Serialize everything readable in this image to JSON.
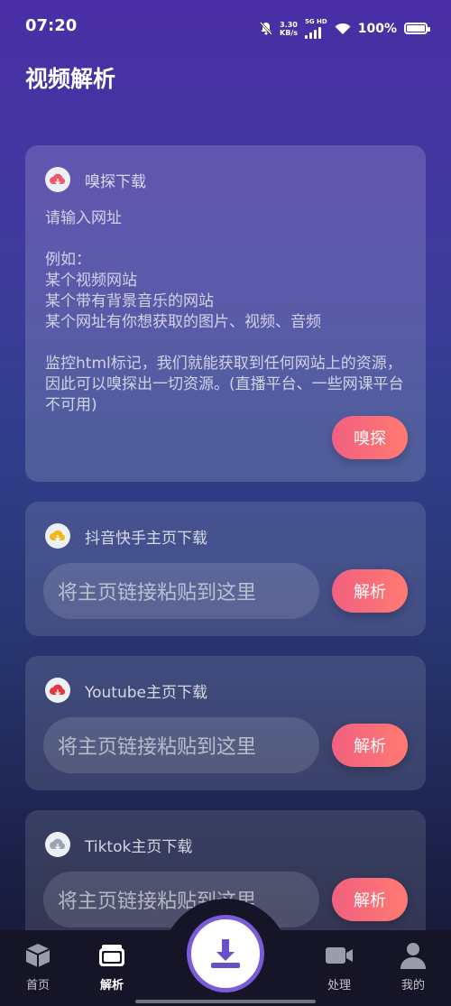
{
  "status_bar": {
    "time": "07:20",
    "net_speed_top": "3.30",
    "net_speed_bottom": "KB/s",
    "net_type": "5G HD",
    "battery": "100%"
  },
  "page_title": "视频解析",
  "sniff_card": {
    "title": "嗅探下载",
    "description": "请输入网址\n\n例如：\n某个视频网站\n某个带有背景音乐的网站\n某个网址有你想获取的图片、视频、音频\n\n监控html标记，我们就能获取到任何网站上的资源，因此可以嗅探出一切资源。(直播平台、一些网课平台不可用)",
    "button": "嗅探"
  },
  "douyin_card": {
    "title": "抖音快手主页下载",
    "placeholder": "将主页链接粘贴到这里",
    "button": "解析"
  },
  "youtube_card": {
    "title": "Youtube主页下载",
    "placeholder": "将主页链接粘贴到这里",
    "button": "解析"
  },
  "tiktok_card": {
    "title": "Tiktok主页下载",
    "placeholder": "将主页链接粘贴到这里",
    "button": "解析"
  },
  "tabbar": {
    "home": "首页",
    "parse": "解析",
    "process": "处理",
    "mine": "我的"
  },
  "colors": {
    "accent": "#f2607f",
    "fab_ring": "#7a5cd8",
    "tabbar_bg": "#151527"
  }
}
